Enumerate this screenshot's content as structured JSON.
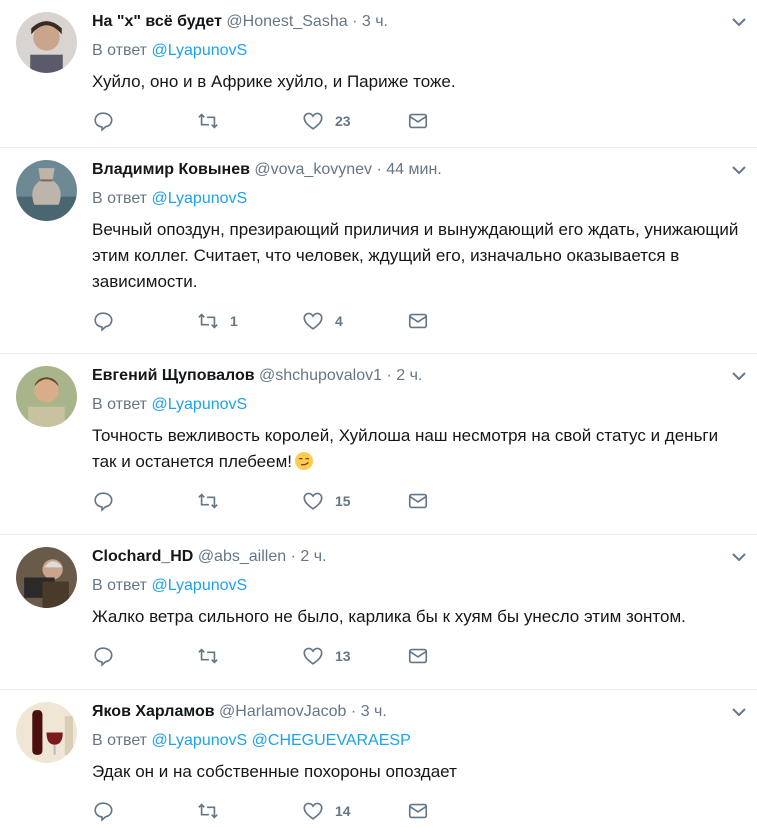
{
  "tweets": [
    {
      "name": "На \"х\" всё будет",
      "handle": "@Honest_Sasha",
      "dot": "·",
      "time": "3 ч.",
      "reply_prefix": "В ответ",
      "mentions": [
        "@LyapunovS"
      ],
      "text": "Хуйло, оно и в Африке хуйло, и Париже тоже.",
      "replies": "",
      "retweets": "",
      "likes": "23"
    },
    {
      "name": "Владимир Ковынев",
      "handle": "@vova_kovynev",
      "dot": "·",
      "time": "44 мин.",
      "reply_prefix": "В ответ",
      "mentions": [
        "@LyapunovS"
      ],
      "text": "Вечный опоздун, презирающий приличия и вынуждающий его ждать, унижающий этим коллег. Считает, что человек, ждущий его, изначально оказывается в зависимости.",
      "replies": "",
      "retweets": "1",
      "likes": "4"
    },
    {
      "name": "Евгений Щуповалов",
      "handle": "@shchupovalov1",
      "dot": "·",
      "time": "2 ч.",
      "reply_prefix": "В ответ",
      "mentions": [
        "@LyapunovS"
      ],
      "text": "Точность вежливость королей, Хуйлоша наш несмотря на свой статус и деньги так и останется плебеем!",
      "emoji": "smirk-emoji",
      "replies": "",
      "retweets": "",
      "likes": "15"
    },
    {
      "name": "Clochard_HD",
      "handle": "@abs_aillen",
      "dot": "·",
      "time": "2 ч.",
      "reply_prefix": "В ответ",
      "mentions": [
        "@LyapunovS"
      ],
      "text": "Жалко ветра сильного не было, карлика бы к хуям бы унесло этим зонтом.",
      "replies": "",
      "retweets": "",
      "likes": "13"
    },
    {
      "name": "Яков Харламов",
      "handle": "@HarlamovJacob",
      "dot": "·",
      "time": "3 ч.",
      "reply_prefix": "В ответ",
      "mentions": [
        "@LyapunovS",
        "@CHEGUEVARAESP"
      ],
      "text": "Эдак он и на собственные похороны опоздает",
      "replies": "",
      "retweets": "",
      "likes": "14"
    }
  ],
  "icons": {
    "reply": "reply-icon",
    "retweet": "retweet-icon",
    "like": "heart-icon",
    "dm": "envelope-icon",
    "menu": "chevron-down-icon"
  },
  "colors": {
    "accent": "#1da1f2",
    "muted": "#657786",
    "divider": "#e6ecf0"
  }
}
